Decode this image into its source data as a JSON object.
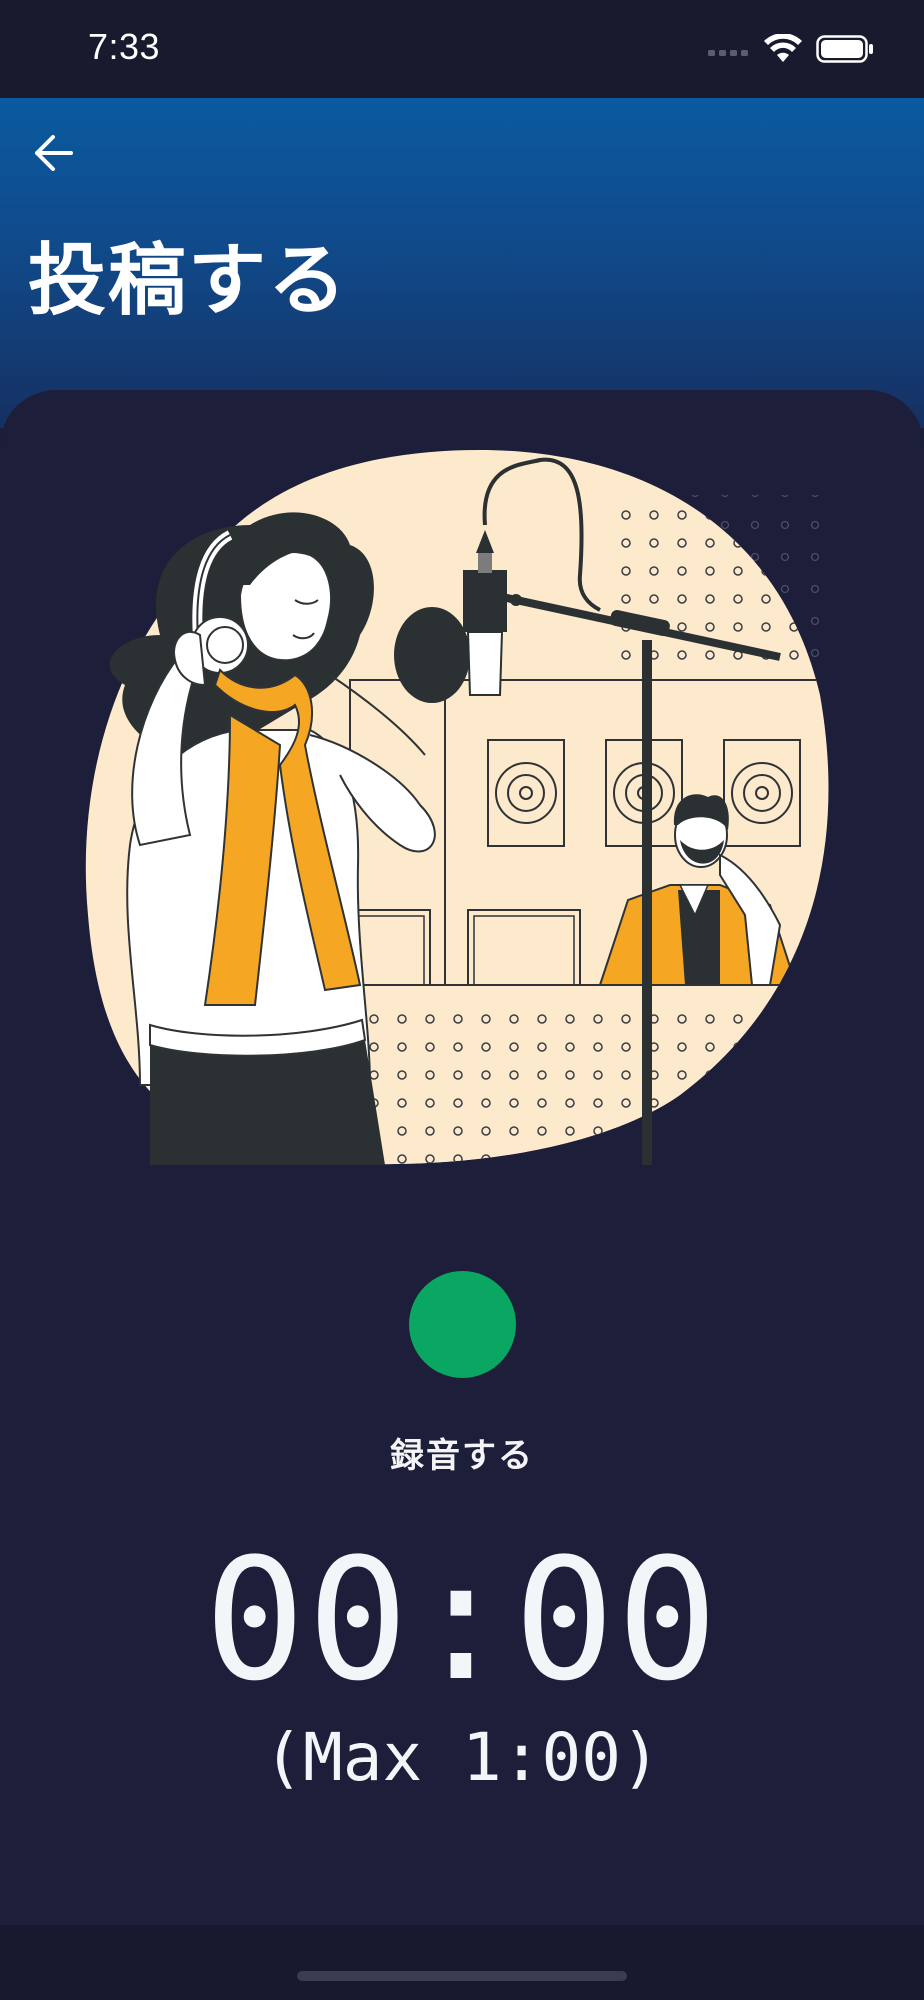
{
  "status_bar": {
    "time": "7:33"
  },
  "header": {
    "back_icon": "arrow-left-icon",
    "title": "投稿する"
  },
  "illustration": {
    "subject": "recording-studio-illustration"
  },
  "recorder": {
    "label": "録音する",
    "elapsed": "00:00",
    "max_duration": "(Max 1:00)",
    "button_color": "#0aa762"
  },
  "colors": {
    "header_gradient_top": "#0a5aa0",
    "header_gradient_bottom": "#163062",
    "card_background": "#1c1e3a",
    "accent_orange": "#f5a623",
    "illustration_background": "#fde9cc"
  }
}
